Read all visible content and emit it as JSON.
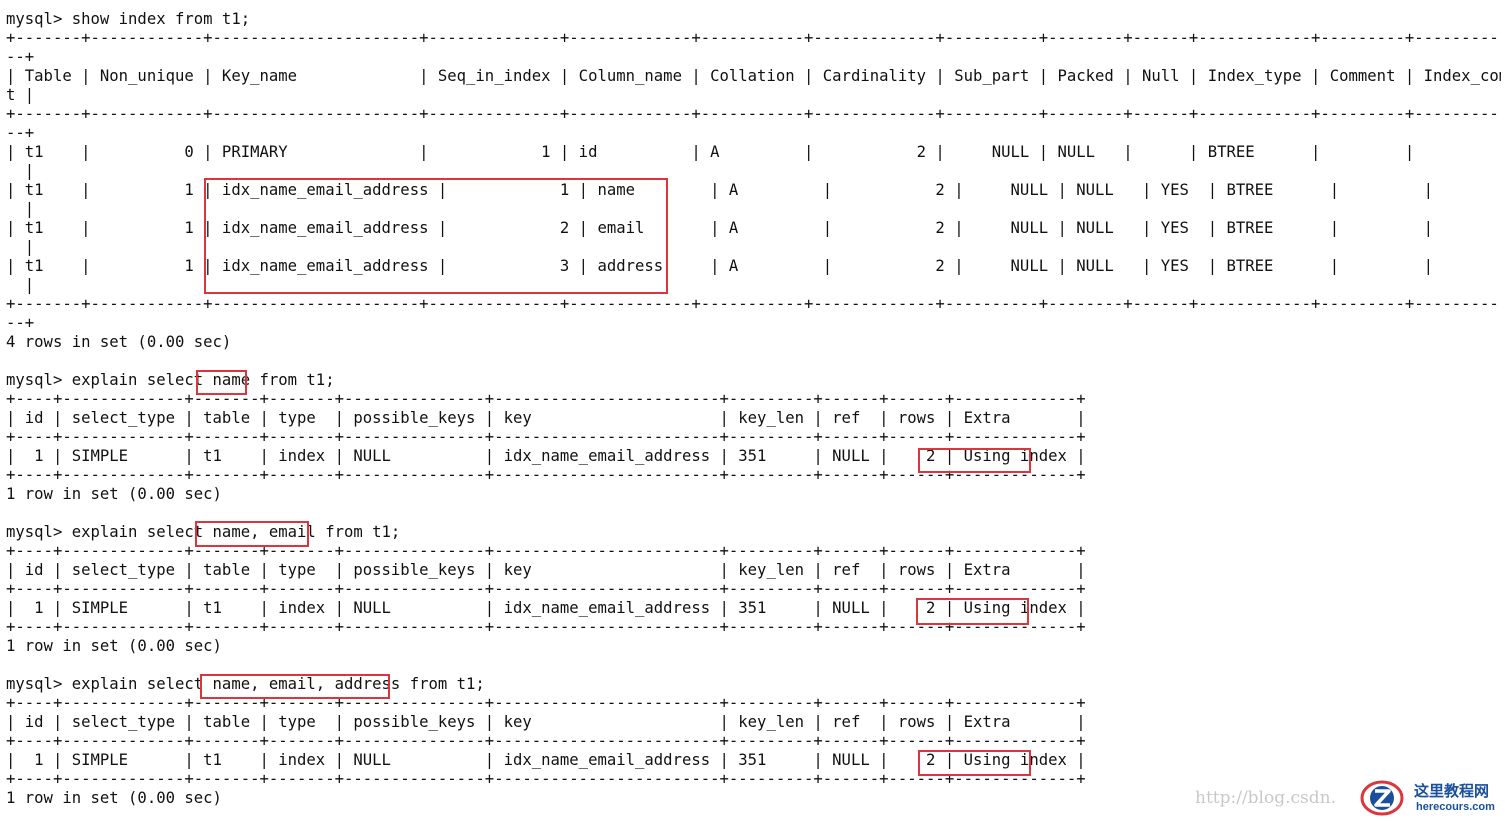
{
  "terminal": {
    "lines": [
      "mysql> show index from t1;",
      "+-------+------------+----------------------+--------------+-------------+-----------+-------------+----------+--------+------+------------+---------+---------------",
      "--+",
      "| Table | Non_unique | Key_name             | Seq_in_index | Column_name | Collation | Cardinality | Sub_part | Packed | Null | Index_type | Comment | Index_commen",
      "t |",
      "+-------+------------+----------------------+--------------+-------------+-----------+-------------+----------+--------+------+------------+---------+---------------",
      "--+",
      "| t1    |          0 | PRIMARY              |            1 | id          | A         |           2 |     NULL | NULL   |      | BTREE      |         |",
      "  |",
      "| t1    |          1 | idx_name_email_address |            1 | name        | A         |           2 |     NULL | NULL   | YES  | BTREE      |         |",
      "  |",
      "| t1    |          1 | idx_name_email_address |            2 | email       | A         |           2 |     NULL | NULL   | YES  | BTREE      |         |",
      "  |",
      "| t1    |          1 | idx_name_email_address |            3 | address     | A         |           2 |     NULL | NULL   | YES  | BTREE      |         |",
      "  |",
      "+-------+------------+----------------------+--------------+-------------+-----------+-------------+----------+--------+------+------------+---------+---------------",
      "--+",
      "4 rows in set (0.00 sec)",
      "",
      "mysql> explain select name from t1;",
      "+----+-------------+-------+-------+---------------+------------------------+---------+------+------+-------------+",
      "| id | select_type | table | type  | possible_keys | key                    | key_len | ref  | rows | Extra       |",
      "+----+-------------+-------+-------+---------------+------------------------+---------+------+------+-------------+",
      "|  1 | SIMPLE      | t1    | index | NULL          | idx_name_email_address | 351     | NULL |    2 | Using index |",
      "+----+-------------+-------+-------+---------------+------------------------+---------+------+------+-------------+",
      "1 row in set (0.00 sec)",
      "",
      "mysql> explain select name, email from t1;",
      "+----+-------------+-------+-------+---------------+------------------------+---------+------+------+-------------+",
      "| id | select_type | table | type  | possible_keys | key                    | key_len | ref  | rows | Extra       |",
      "+----+-------------+-------+-------+---------------+------------------------+---------+------+------+-------------+",
      "|  1 | SIMPLE      | t1    | index | NULL          | idx_name_email_address | 351     | NULL |    2 | Using index |",
      "+----+-------------+-------+-------+---------------+------------------------+---------+------+------+-------------+",
      "1 row in set (0.00 sec)",
      "",
      "mysql> explain select name, email, address from t1;",
      "+----+-------------+-------+-------+---------------+------------------------+---------+------+------+-------------+",
      "| id | select_type | table | type  | possible_keys | key                    | key_len | ref  | rows | Extra       |",
      "+----+-------------+-------+-------+---------------+------------------------+---------+------+------+-------------+",
      "|  1 | SIMPLE      | t1    | index | NULL          | idx_name_email_address | 351     | NULL |    2 | Using index |",
      "+----+-------------+-------+-------+---------------+------------------------+---------+------+------+-------------+",
      "1 row in set (0.00 sec)"
    ]
  },
  "colors": {
    "highlight_border": "#d9363e",
    "text": "#111111",
    "background": "#ffffff",
    "watermark": "#c8c8c8",
    "logo_blue": "#1a4f9c"
  },
  "watermark": {
    "url_text": "http://blog.csdn."
  },
  "logo": {
    "cn_text": "这里教程网",
    "en_text": "herecours.com",
    "icon": "z-letter-logo-icon"
  }
}
